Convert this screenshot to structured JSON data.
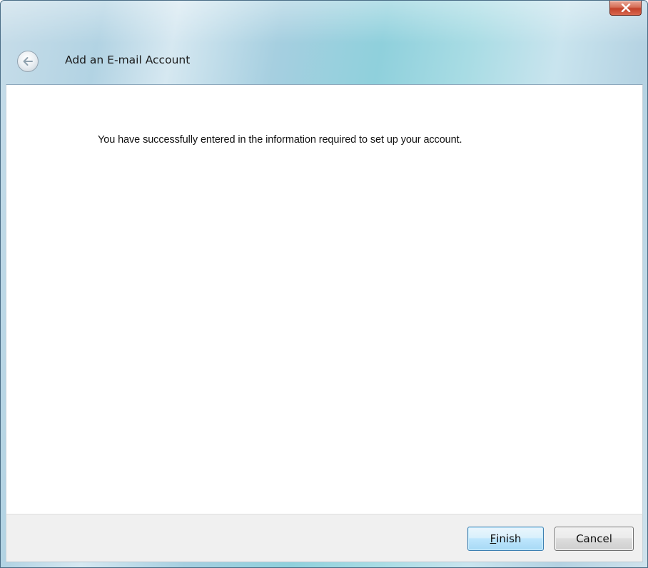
{
  "window": {
    "title": "Add an E-mail Account"
  },
  "message": "You have successfully entered in the information required to set up your account.",
  "buttons": {
    "finish": {
      "mnemonic": "F",
      "rest": "inish"
    },
    "cancel": "Cancel"
  },
  "icons": {
    "close": "close-icon",
    "back": "back-arrow-icon"
  }
}
